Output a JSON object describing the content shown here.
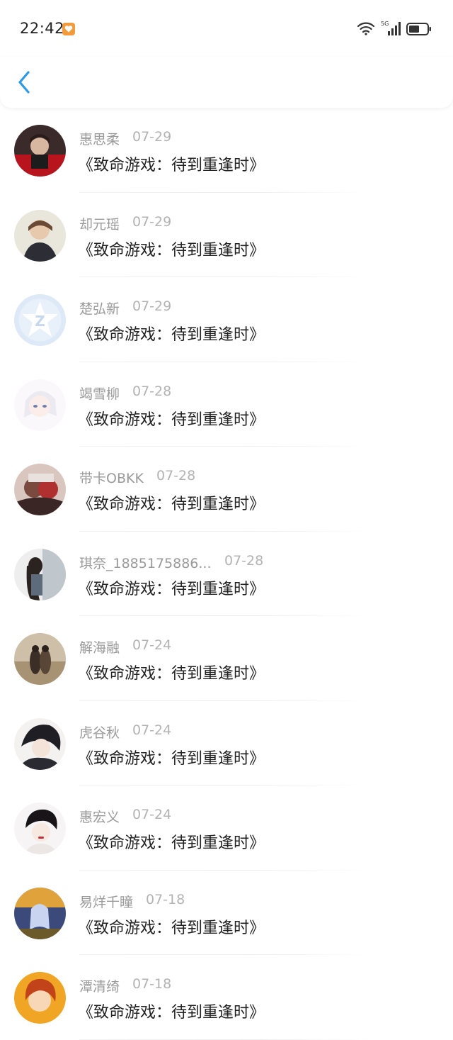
{
  "status_bar": {
    "time": "22:42",
    "network_label": "5G",
    "icons": [
      "app-badge-icon",
      "wifi-icon",
      "cellular-signal-icon",
      "battery-icon"
    ]
  },
  "nav": {
    "back_icon": "chevron-left-icon",
    "accent_color": "#2e9ae6"
  },
  "items": [
    {
      "name": "惠思柔",
      "date": "07-29",
      "title": "《致命游戏：待到重逢时》"
    },
    {
      "name": "却元瑶",
      "date": "07-29",
      "title": "《致命游戏：待到重逢时》"
    },
    {
      "name": "楚弘新",
      "date": "07-29",
      "title": "《致命游戏：待到重逢时》"
    },
    {
      "name": "竭雪柳",
      "date": "07-28",
      "title": "《致命游戏：待到重逢时》"
    },
    {
      "name": "带卡OBKK",
      "date": "07-28",
      "title": "《致命游戏：待到重逢时》"
    },
    {
      "name": "琪奈_1885175886...",
      "date": "07-28",
      "title": "《致命游戏：待到重逢时》"
    },
    {
      "name": "解海融",
      "date": "07-24",
      "title": "《致命游戏：待到重逢时》"
    },
    {
      "name": "虎谷秋",
      "date": "07-24",
      "title": "《致命游戏：待到重逢时》"
    },
    {
      "name": "惠宏义",
      "date": "07-24",
      "title": "《致命游戏：待到重逢时》"
    },
    {
      "name": "易烊千瞳",
      "date": "07-18",
      "title": "《致命游戏：待到重逢时》"
    },
    {
      "name": "潭清绮",
      "date": "07-18",
      "title": "《致命游戏：待到重逢时》"
    }
  ]
}
